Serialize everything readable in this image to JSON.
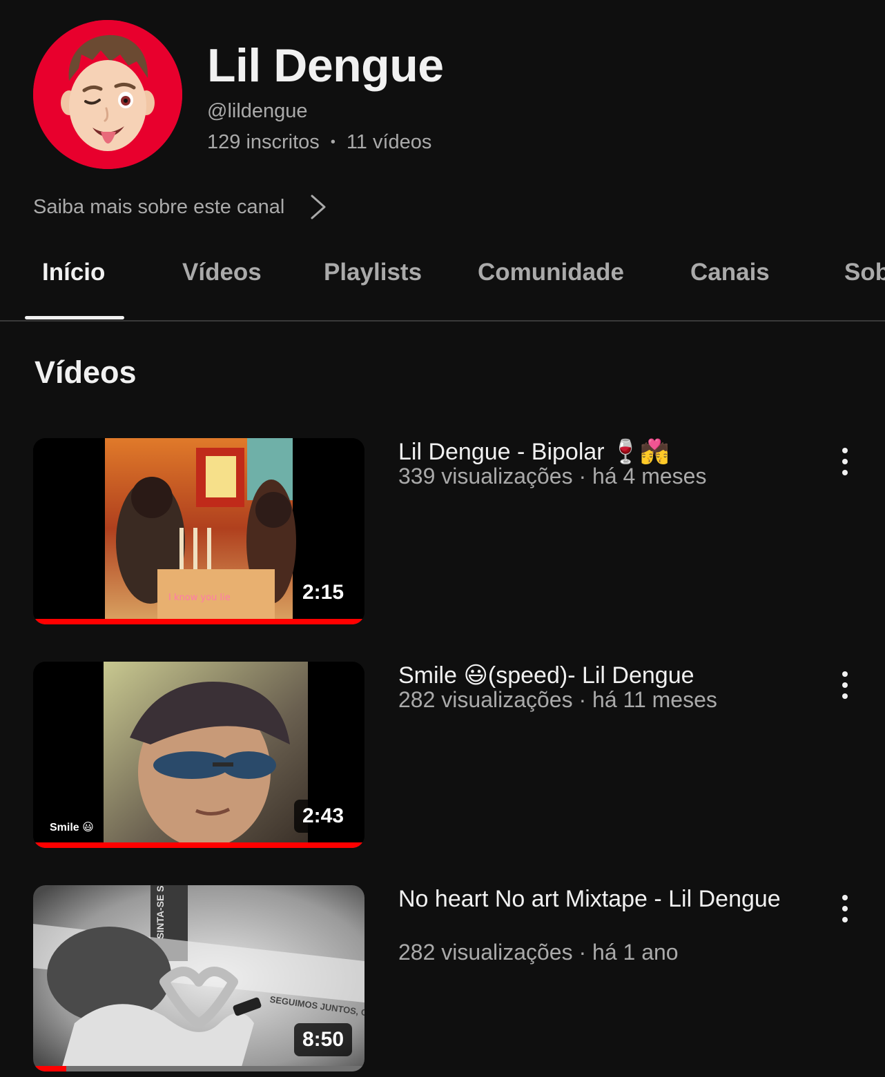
{
  "channel": {
    "name": "Lil Dengue",
    "handle": "@lildengue",
    "subscribers": "129 inscritos",
    "separator": "•",
    "videos_count": "11 vídeos",
    "about_link": "Saiba mais sobre este canal",
    "avatar_color": "#e8002d"
  },
  "tabs": [
    {
      "label": "Início",
      "active": true
    },
    {
      "label": "Vídeos",
      "active": false
    },
    {
      "label": "Playlists",
      "active": false
    },
    {
      "label": "Comunidade",
      "active": false
    },
    {
      "label": "Canais",
      "active": false
    },
    {
      "label": "Sob",
      "active": false
    }
  ],
  "section": {
    "title": "Vídeos"
  },
  "videos": [
    {
      "title": "Lil Dengue - Bipolar 🍷💏",
      "meta": "339 visualizações · há 4 meses",
      "duration": "2:15",
      "thumb_caption": "I know you lie",
      "watched_fraction": 1.0
    },
    {
      "title": "Smile 😃(speed)- Lil Dengue",
      "meta": "282 visualizações · há 11 meses",
      "duration": "2:43",
      "thumb_caption": "Smile 😃",
      "watched_fraction": 1.0
    },
    {
      "title": "No heart No art Mixtape - Lil Dengue",
      "meta": "282 visualizações · há 1 ano",
      "duration": "8:50",
      "thumb_caption": "SINTA-SE SEU",
      "thumb_caption_2": "SEGUIMOS JUNTOS, COM O",
      "watched_fraction": 0.1
    }
  ],
  "colors": {
    "background": "#0f0f0f",
    "text_primary": "#f1f1f1",
    "text_secondary": "#aaaaaa",
    "progress": "#ff0000"
  }
}
